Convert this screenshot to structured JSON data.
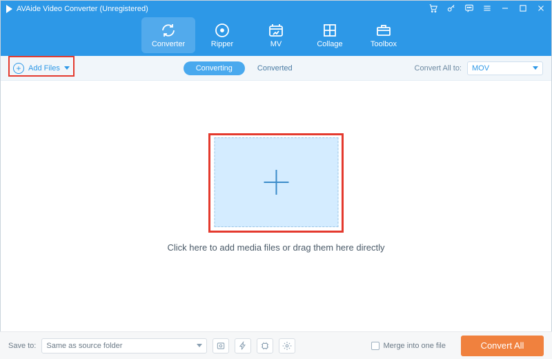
{
  "titlebar": {
    "title": "AVAide Video Converter (Unregistered)"
  },
  "nav": {
    "items": [
      {
        "label": "Converter"
      },
      {
        "label": "Ripper"
      },
      {
        "label": "MV"
      },
      {
        "label": "Collage"
      },
      {
        "label": "Toolbox"
      }
    ]
  },
  "subbar": {
    "add_files": "Add Files",
    "tabs": {
      "converting": "Converting",
      "converted": "Converted"
    },
    "convert_all_label": "Convert All to:",
    "format": "MOV"
  },
  "drop": {
    "hint": "Click here to add media files or drag them here directly"
  },
  "bottom": {
    "save_to_label": "Save to:",
    "save_to_value": "Same as source folder",
    "merge_label": "Merge into one file",
    "convert_all": "Convert All"
  }
}
